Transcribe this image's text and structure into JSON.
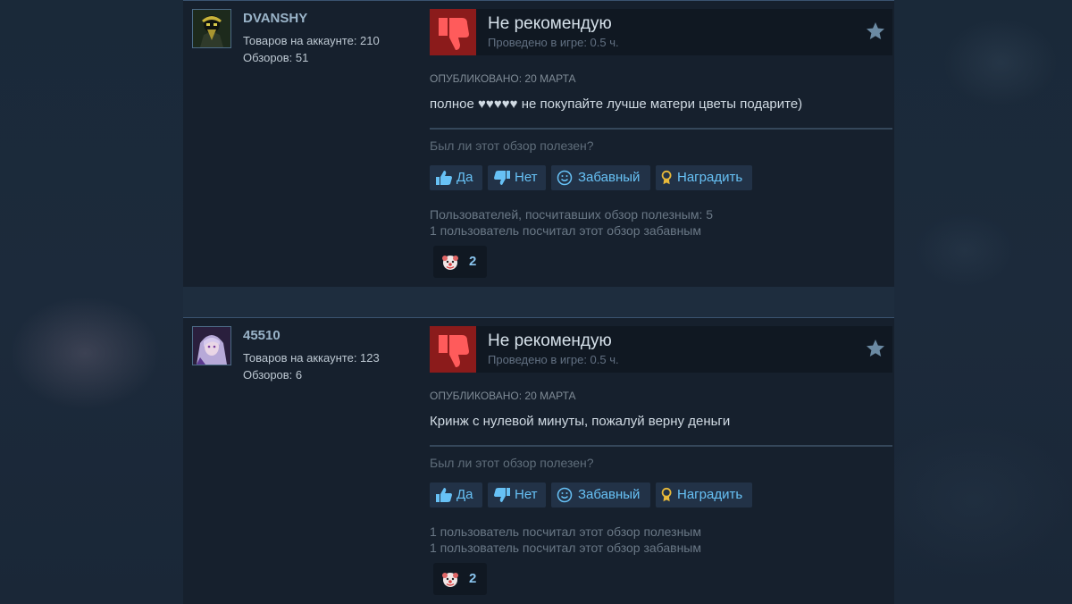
{
  "reviews": [
    {
      "author": {
        "name": "DVANSHY",
        "products": "Товаров на аккаунте: 210",
        "reviews": "Обзоров: 51"
      },
      "verdict": "Не рекомендую",
      "playtime": "Проведено в игре: 0.5 ч.",
      "posted": "ОПУБЛИКОВАНО: 20 МАРТА",
      "text": "полное ♥♥♥♥♥ не покупайте лучше матери цветы подарите)",
      "helpful_question": "Был ли этот обзор полезен?",
      "buttons": {
        "yes": "Да",
        "no": "Нет",
        "funny": "Забавный",
        "award": "Наградить"
      },
      "helpful_count": "Пользователей, посчитавших обзор полезным: 5",
      "funny_count": "1 пользователь посчитал этот обзор забавным",
      "award_count": "2"
    },
    {
      "author": {
        "name": "45510",
        "products": "Товаров на аккаунте: 123",
        "reviews": "Обзоров: 6"
      },
      "verdict": "Не рекомендую",
      "playtime": "Проведено в игре: 0.5 ч.",
      "posted": "ОПУБЛИКОВАНО: 20 МАРТА",
      "text": "Кринж с нулевой минуты, пожалуй верну деньги",
      "helpful_question": "Был ли этот обзор полезен?",
      "buttons": {
        "yes": "Да",
        "no": "Нет",
        "funny": "Забавный",
        "award": "Наградить"
      },
      "helpful_count": "1 пользователь посчитал этот обзор полезным",
      "funny_count": "1 пользователь посчитал этот обзор забавным",
      "award_count": "2"
    }
  ],
  "icons": {
    "verdict": "thumbs-down-icon",
    "star": "star-icon",
    "yes": "thumbs-up-icon",
    "no": "thumbs-down-icon",
    "funny": "smiley-icon",
    "award": "award-ribbon-icon",
    "award_badge": "clown-face-icon"
  },
  "colors": {
    "background": "#1b2838",
    "panel": "#16202d",
    "negative": "#8b1b1b",
    "link": "#67c1f5",
    "button_bg": "#223247"
  }
}
